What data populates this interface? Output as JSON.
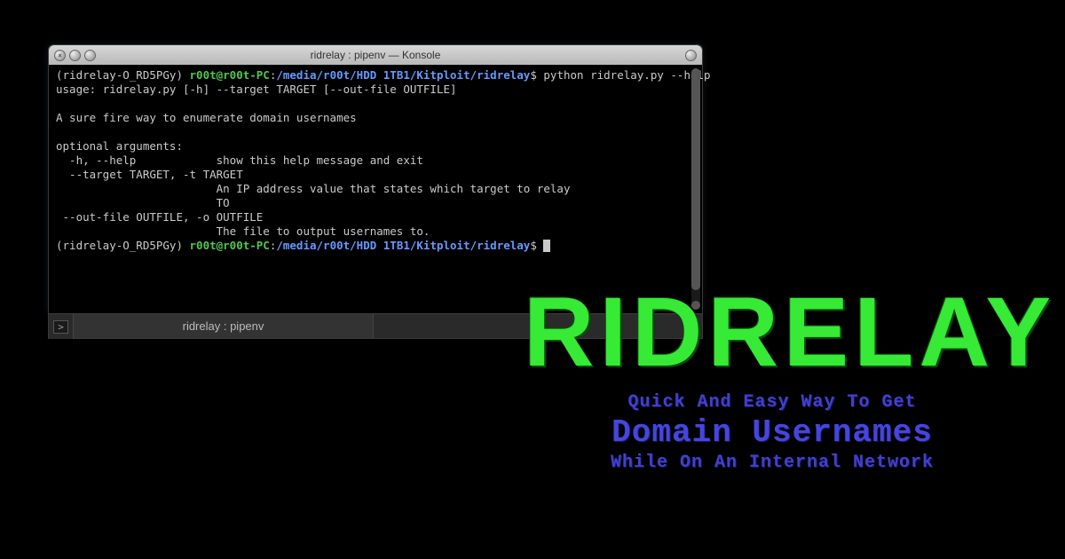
{
  "window": {
    "title": "ridrelay : pipenv — Konsole"
  },
  "prompt1": {
    "venv": "(ridrelay-O_RD5PGy) ",
    "user": "r00t@r00t-PC",
    "sep": ":",
    "path": "/media/r00t/HDD 1TB1/Kitploit/ridrelay",
    "dollar": "$ ",
    "command": "python ridrelay.py --help"
  },
  "output": {
    "l1": "usage: ridrelay.py [-h] --target TARGET [--out-file OUTFILE]",
    "l2": "",
    "l3": "A sure fire way to enumerate domain usernames",
    "l4": "",
    "l5": "optional arguments:",
    "l6": "  -h, --help            show this help message and exit",
    "l7": "  --target TARGET, -t TARGET",
    "l8": "                        An IP address value that states which target to relay",
    "l9": "                        TO",
    "l10": " --out-file OUTFILE, -o OUTFILE",
    "l11": "                        The file to output usernames to."
  },
  "prompt2": {
    "venv": "(ridrelay-O_RD5PGy) ",
    "user": "r00t@r00t-PC",
    "sep": ":",
    "path": "/media/r00t/HDD 1TB1/Kitploit/ridrelay",
    "dollar": "$ "
  },
  "tab": {
    "label": "ridrelay : pipenv"
  },
  "promo": {
    "title": "RIDRELAY",
    "line1": "Quick And Easy Way To Get",
    "line2": "Domain Usernames",
    "line3": "While On An Internal Network"
  }
}
